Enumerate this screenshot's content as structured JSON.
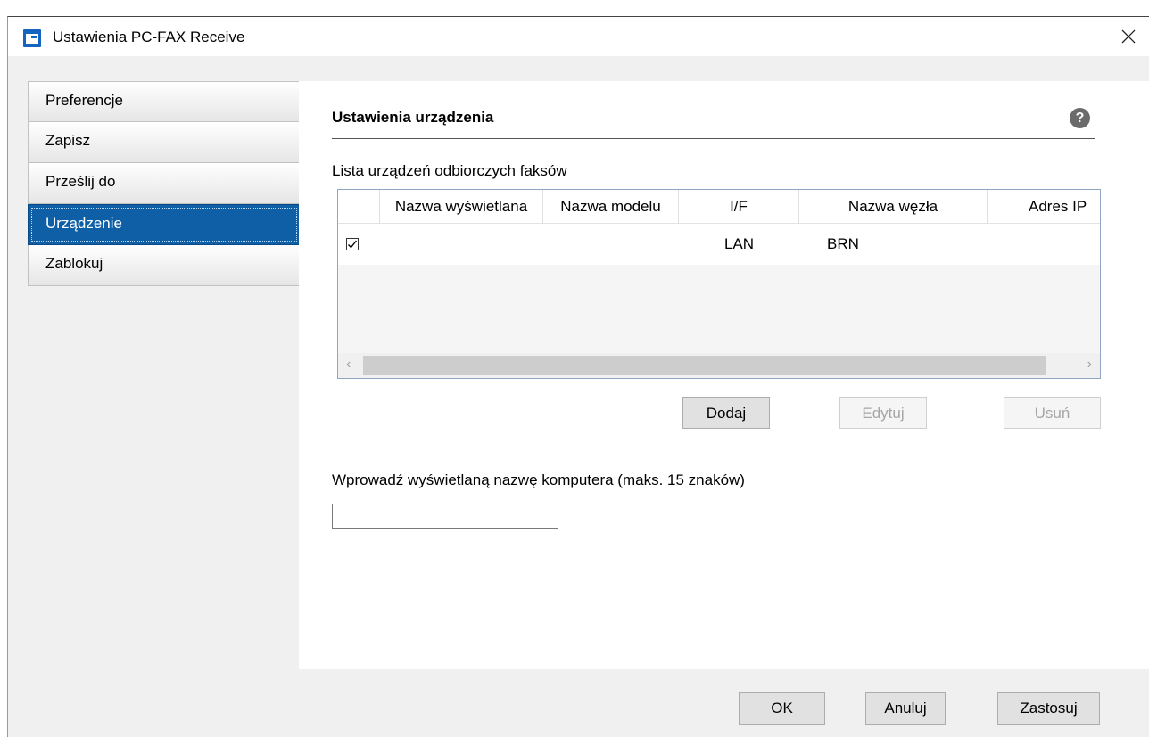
{
  "window": {
    "title": "Ustawienia PC-FAX Receive"
  },
  "icons": {
    "app": "fax-app-icon",
    "close": "close-icon",
    "help": "help-icon",
    "check": "checkmark-icon"
  },
  "sidebar": {
    "items": [
      {
        "label": "Preferencje",
        "active": false
      },
      {
        "label": "Zapisz",
        "active": false
      },
      {
        "label": "Prześlij do",
        "active": false
      },
      {
        "label": "Urządzenie",
        "active": true
      },
      {
        "label": "Zablokuj",
        "active": false
      }
    ]
  },
  "main": {
    "section_title": "Ustawienia urządzenia",
    "help_glyph": "?",
    "list_label": "Lista urządzeń odbiorczych faksów",
    "table": {
      "columns": [
        "Nazwa wyświetlana",
        "Nazwa modelu",
        "I/F",
        "Nazwa węzła",
        "Adres IP"
      ],
      "rows": [
        {
          "checked": true,
          "display_name": "",
          "model": "",
          "interface": "LAN",
          "node_name": "BRN",
          "ip": ""
        }
      ]
    },
    "buttons": {
      "add": "Dodaj",
      "edit": "Edytuj",
      "delete": "Usuń"
    },
    "computer_name_label": "Wprowadź wyświetlaną nazwę komputera (maks. 15 znaków)",
    "computer_name_value": ""
  },
  "footer": {
    "ok": "OK",
    "cancel": "Anuluj",
    "apply": "Zastosuj"
  },
  "colors": {
    "accent": "#0e5fa6",
    "app_icon": "#1565c0"
  }
}
